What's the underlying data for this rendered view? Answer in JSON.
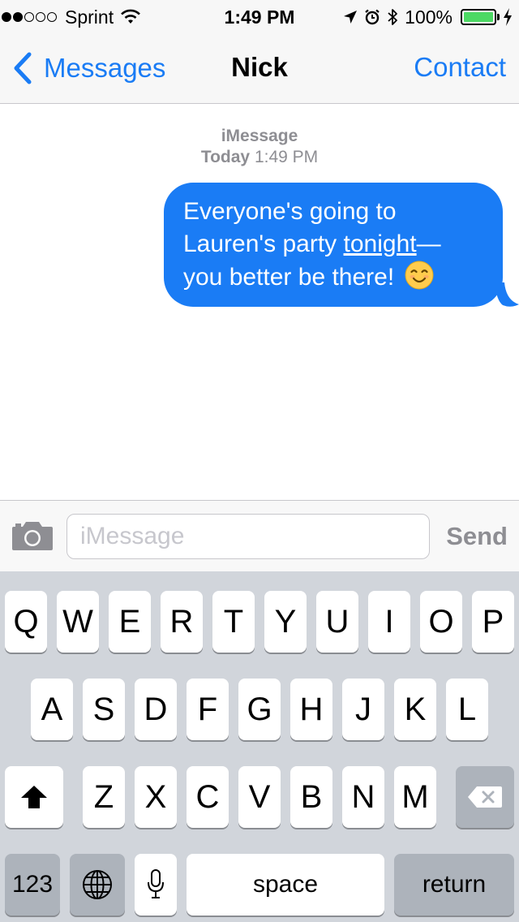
{
  "status_bar": {
    "carrier": "Sprint",
    "signal_bars_filled": 2,
    "signal_bars_total": 5,
    "time": "1:49 PM",
    "battery_percent": "100%",
    "battery_color": "#4cd964",
    "icons": [
      "wifi-icon",
      "location-arrow-icon",
      "alarm-icon",
      "bluetooth-icon",
      "charging-bolt-icon"
    ]
  },
  "nav": {
    "back_label": "Messages",
    "title": "Nick",
    "contact_label": "Contact"
  },
  "conversation": {
    "service": "iMessage",
    "day": "Today",
    "time": "1:49 PM",
    "messages": [
      {
        "direction": "outgoing",
        "line1": "Everyone's going to",
        "line2_prefix": "Lauren's party ",
        "link": "tonight",
        "line2_suffix": "—",
        "line3": "you better be there!",
        "emoji": "smiling-face-emoji"
      }
    ]
  },
  "composer": {
    "placeholder": "iMessage",
    "value": "",
    "send_label": "Send"
  },
  "keyboard": {
    "row1": [
      "Q",
      "W",
      "E",
      "R",
      "T",
      "Y",
      "U",
      "I",
      "O",
      "P"
    ],
    "row2": [
      "A",
      "S",
      "D",
      "F",
      "G",
      "H",
      "J",
      "K",
      "L"
    ],
    "row3": [
      "Z",
      "X",
      "C",
      "V",
      "B",
      "N",
      "M"
    ],
    "numbers_label": "123",
    "space_label": "space",
    "return_label": "return"
  },
  "colors": {
    "accent": "#1a7cf5",
    "bubble": "#1a7cf5",
    "keyboard_bg": "#d1d5db",
    "special_key": "#adb3bb"
  }
}
